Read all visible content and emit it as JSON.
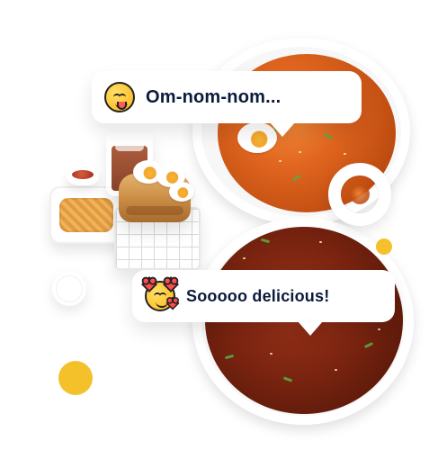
{
  "bubbles": [
    {
      "text": "Om-nom-nom..."
    },
    {
      "text": "Sooooo delicious!"
    }
  ],
  "icons": {
    "bubble_1_emoji": "yum-emoji-icon",
    "bubble_2_emoji": "love-emoji-icon"
  },
  "colors": {
    "text": "#0c1b3a",
    "accent_yellow": "#f4c12b"
  }
}
